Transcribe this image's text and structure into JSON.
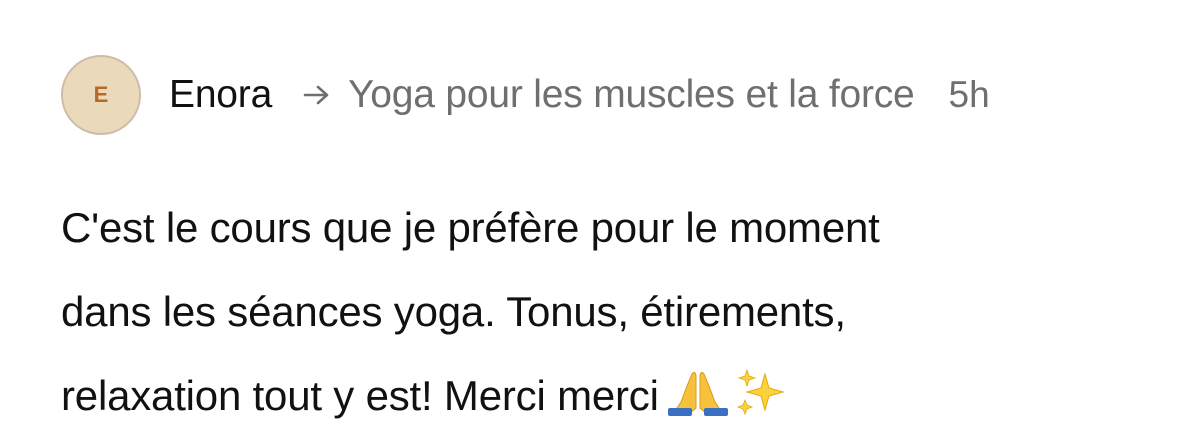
{
  "comment": {
    "avatar_initial": "E",
    "author": "Enora",
    "arrow_icon": "arrow-right-icon",
    "course": "Yoga pour les muscles et la force",
    "time": "5h",
    "body_lines": [
      "C'est le cours que je préfère pour le moment",
      "dans les séances yoga. Tonus, étirements,",
      "relaxation tout y est! Merci merci"
    ],
    "emojis": [
      "pray-emoji",
      "sparkles-emoji"
    ]
  },
  "colors": {
    "avatar_bg": "#ebd9bc",
    "avatar_text": "#b66a25",
    "secondary_text": "#6f6f6f",
    "primary_text": "#111111"
  }
}
